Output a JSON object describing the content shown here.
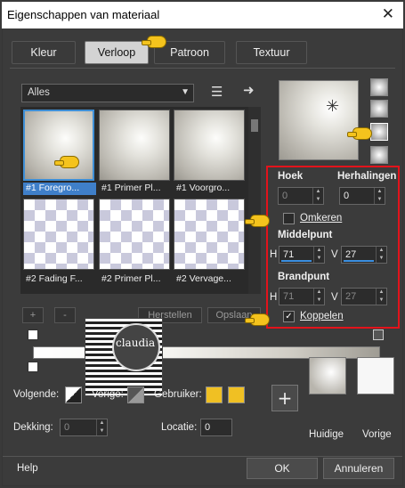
{
  "title": "Eigenschappen van materiaal",
  "tabs": [
    "Kleur",
    "Verloop",
    "Patroon",
    "Textuur"
  ],
  "category": "Alles",
  "thumbs": [
    "#1 Foregro...",
    "#1 Primer Pl...",
    "#1 Voorgro...",
    "#2 Fading F...",
    "#2 Primer Pl...",
    "#2 Vervage..."
  ],
  "buttons": {
    "add": "+",
    "remove": "-",
    "reset": "Herstellen",
    "save": "Opslaan",
    "ok": "OK",
    "cancel": "Annuleren",
    "help": "Help"
  },
  "fields": {
    "angle_label": "Hoek",
    "repeats_label": "Herhalingen",
    "angle": "0",
    "repeats": "0",
    "invert": "Omkeren",
    "mid_label": "Middelpunt",
    "focal_label": "Brandpunt",
    "h": "H",
    "v": "V",
    "mid_h": "71",
    "mid_v": "27",
    "focal_h": "71",
    "focal_v": "27",
    "link": "Koppelen"
  },
  "bottom": {
    "follow": "Volgende:",
    "prev": "Vorige:",
    "user": "Gebruiker:",
    "opacity_label": "Dekking:",
    "opacity": "0",
    "location_label": "Locatie:",
    "location": "0",
    "current": "Huidige",
    "previous": "Vorige"
  },
  "watermark": "claudia",
  "colors": {
    "accent": "#3f8fd6",
    "highlight": "#e3131b",
    "user_swatch": "#f0c023"
  }
}
